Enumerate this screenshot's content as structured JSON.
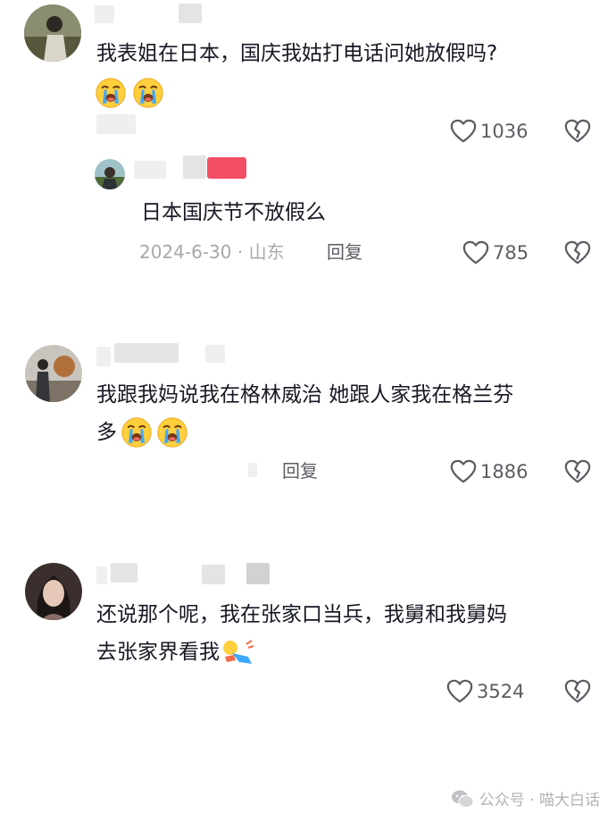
{
  "comments": [
    {
      "text": "我表姐在日本，国庆我姑打电话问她放假吗?",
      "emoji": "crying-emoji",
      "likes": "1036",
      "reply": {
        "text": "日本国庆节不放假么",
        "date": "2024-6-30",
        "location": "山东",
        "reply_label": "回复",
        "likes": "785"
      }
    },
    {
      "text_line1": "我跟我妈说我在格林威治 她跟人家我在格兰芬",
      "text_line2": "多",
      "emoji": "crying-emoji",
      "reply_label": "回复",
      "likes": "1886"
    },
    {
      "text_line1": "还说那个呢，我在张家口当兵，我舅和我舅妈",
      "text_line2": "去张家界看我",
      "emoji": "fall-down-emoji",
      "likes": "3524"
    }
  ],
  "footer": {
    "source": "公众号 · 喵大白话",
    "icon": "wechat-icon"
  },
  "colors": {
    "text": "#161823",
    "meta": "#a8a8ad",
    "emoji_face": "#ffcf3d",
    "tears": "#3ea7ff",
    "redaction_pink": "#f0304c"
  }
}
